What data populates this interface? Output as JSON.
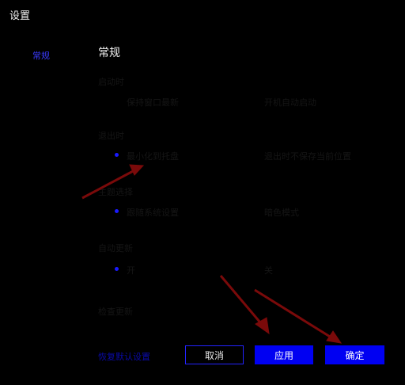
{
  "window": {
    "title": "设置"
  },
  "sidebar": {
    "items": [
      {
        "label": "常规"
      }
    ]
  },
  "main": {
    "section_title": "常规",
    "groups": [
      {
        "label": "启动时",
        "options": [
          {
            "label": "保持窗口最新",
            "selected": false
          },
          {
            "label": "开机自动启动",
            "selected": false
          }
        ]
      },
      {
        "label": "退出时",
        "options": [
          {
            "label": "最小化到托盘",
            "selected": true
          },
          {
            "label": "退出时不保存当前位置",
            "selected": false
          }
        ]
      },
      {
        "label": "主题选择",
        "options": [
          {
            "label": "跟随系统设置",
            "selected": true
          },
          {
            "label": "暗色模式",
            "selected": false
          }
        ]
      },
      {
        "label": "自动更新",
        "options": [
          {
            "label": "开",
            "selected": true
          },
          {
            "label": "关",
            "selected": false
          }
        ]
      },
      {
        "label": "检查更新",
        "options": []
      }
    ],
    "reset_link": "恢复默认设置"
  },
  "buttons": {
    "cancel": "取消",
    "apply": "应用",
    "ok": "确定"
  },
  "colors": {
    "accent": "#0000f2",
    "link": "#3a3aff",
    "annotation_arrow": "#7a0a0a"
  }
}
